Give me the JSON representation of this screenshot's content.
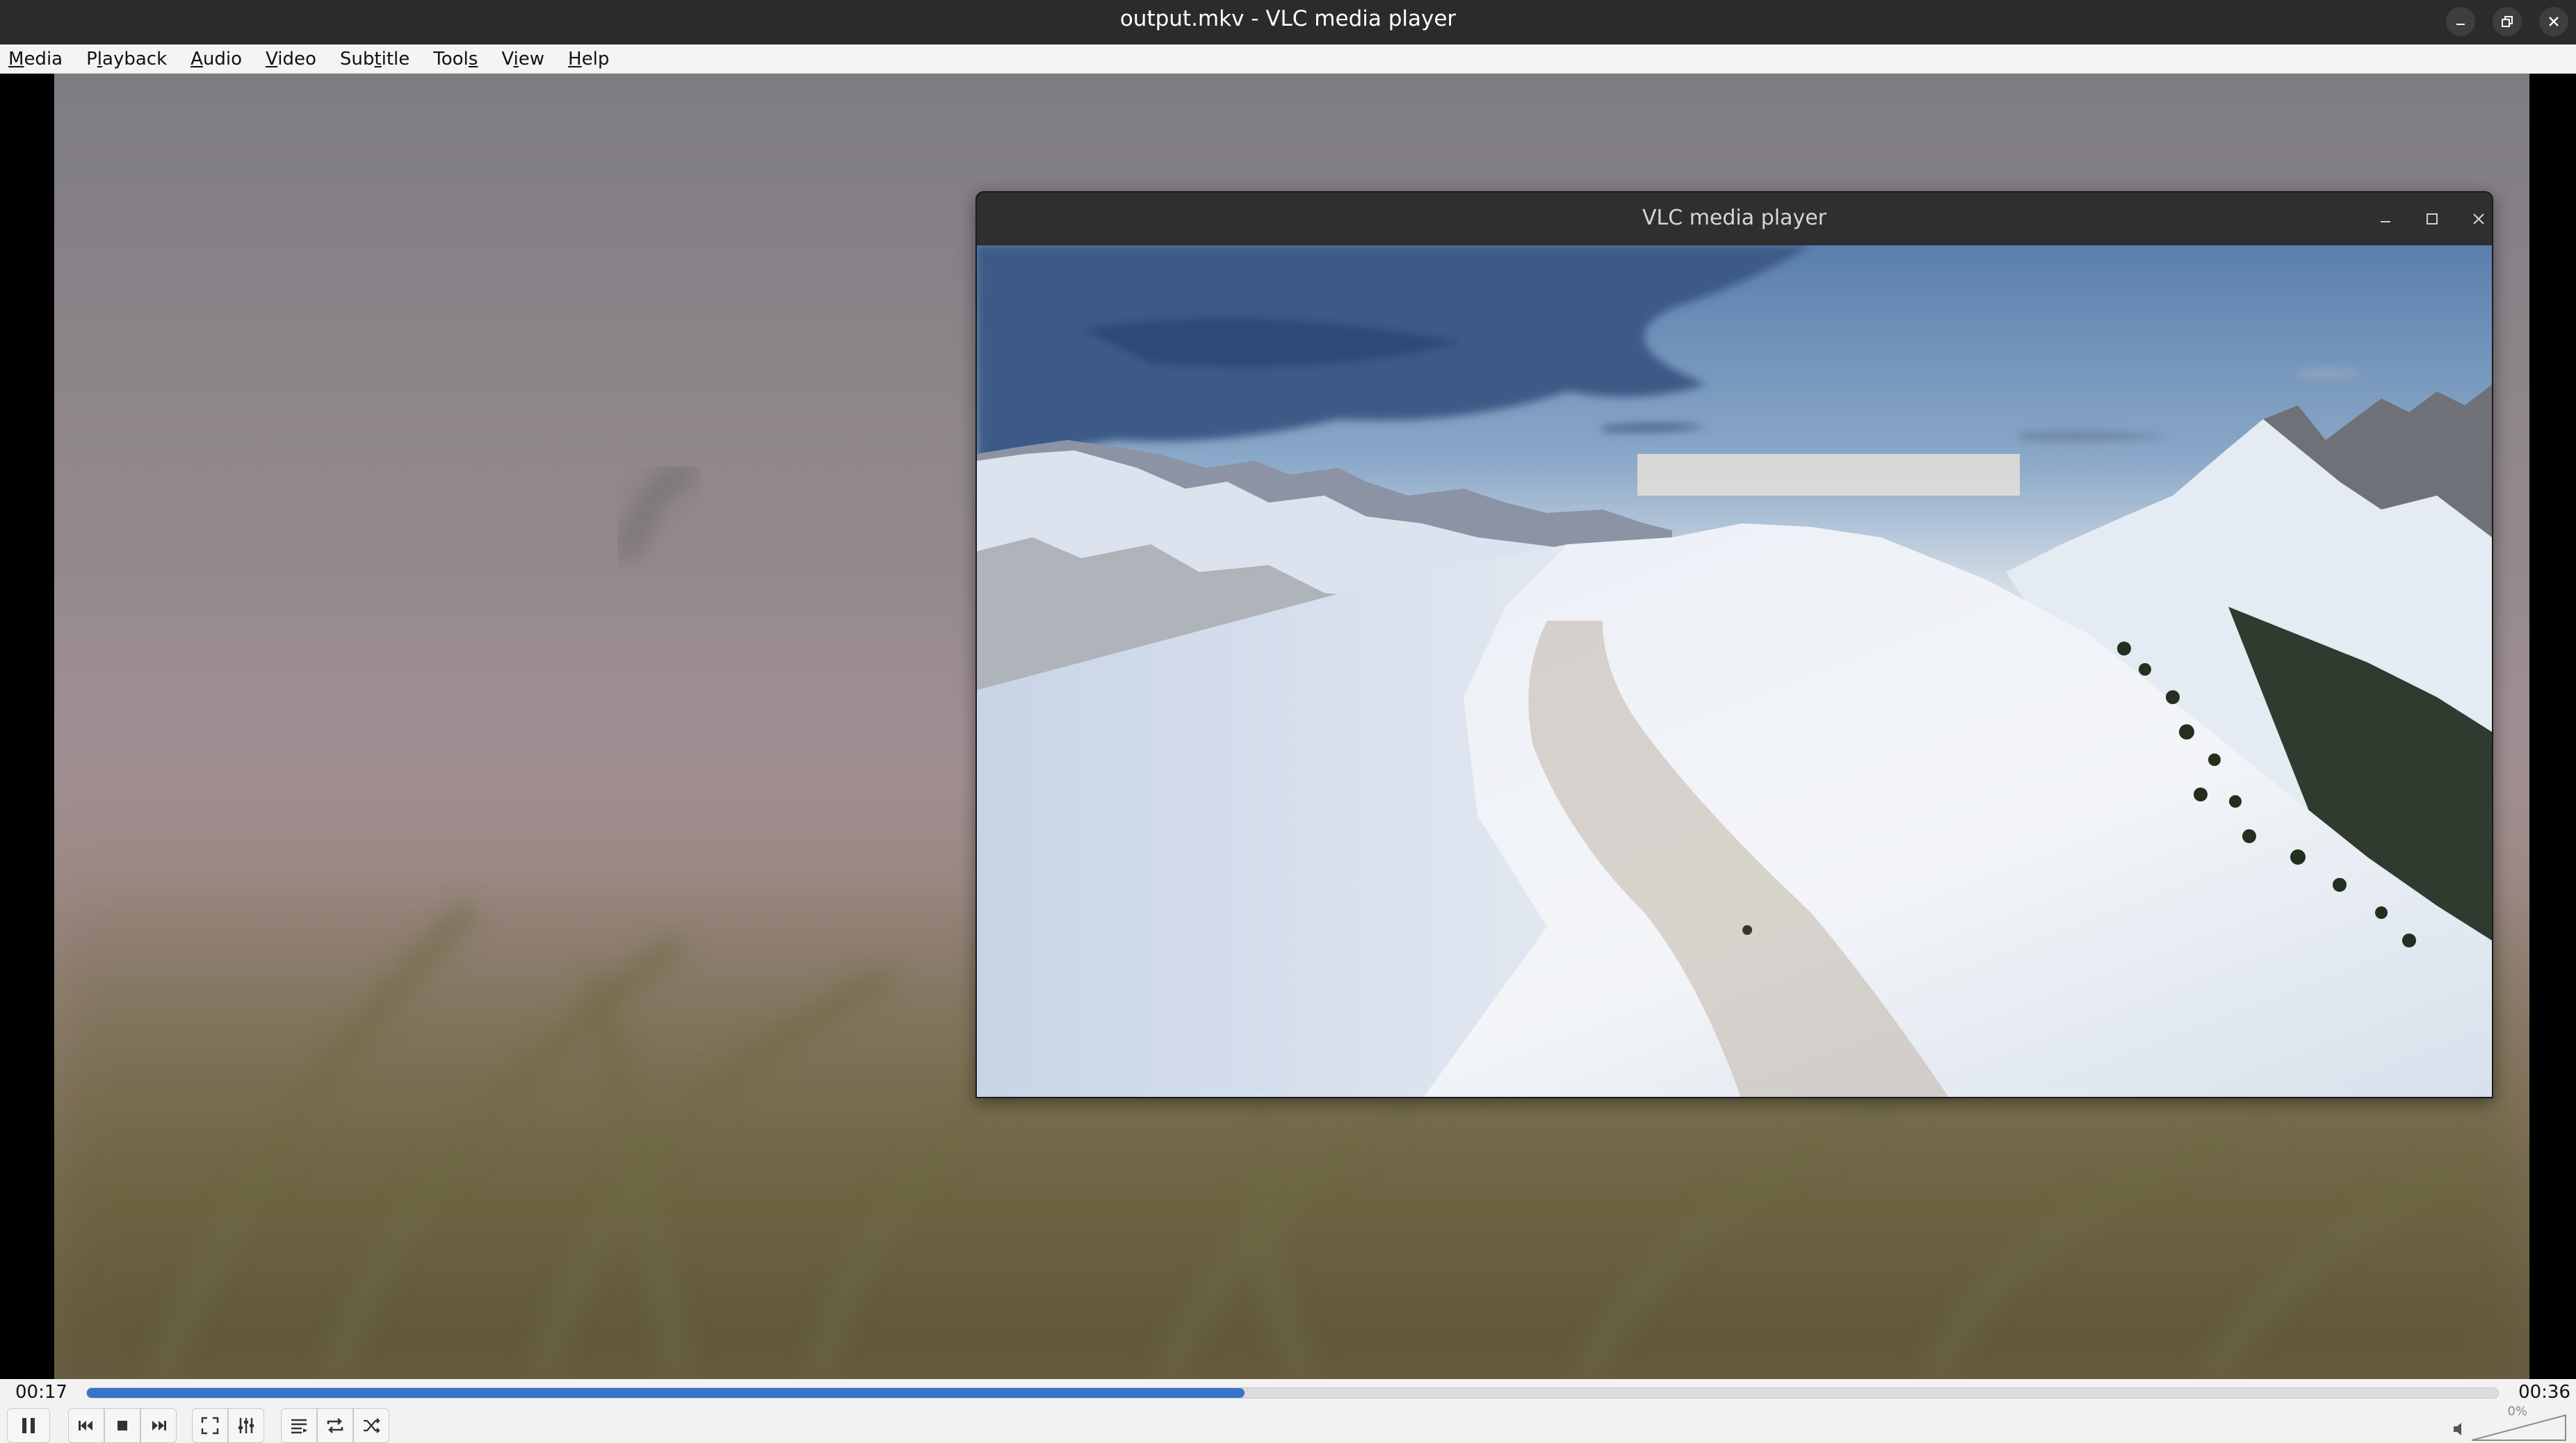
{
  "window": {
    "title": "output.mkv - VLC media player",
    "controls": [
      "minimize-icon",
      "restore-icon",
      "close-icon"
    ]
  },
  "menu": [
    {
      "label": "Media",
      "mnemonic": "M"
    },
    {
      "label": "Playback",
      "mnemonic": "l"
    },
    {
      "label": "Audio",
      "mnemonic": "A"
    },
    {
      "label": "Video",
      "mnemonic": "V"
    },
    {
      "label": "Subtitle",
      "mnemonic": "t"
    },
    {
      "label": "Tools",
      "mnemonic": "s"
    },
    {
      "label": "View",
      "mnemonic": "i"
    },
    {
      "label": "Help",
      "mnemonic": "H"
    }
  ],
  "sub_window": {
    "title": "VLC media player",
    "controls": [
      "minimize-icon",
      "maximize-icon",
      "close-icon"
    ]
  },
  "playback": {
    "elapsed": "00:17",
    "total": "00:36",
    "progress": 0.48
  },
  "volume": {
    "label": "0%",
    "level": 0
  },
  "controls": [
    "pause-icon",
    "previous-icon",
    "stop-icon",
    "next-icon",
    "fullscreen-icon",
    "extended-settings-icon",
    "playlist-icon",
    "loop-icon",
    "shuffle-icon"
  ],
  "colors": {
    "accent": "#3574c9",
    "titlebar": "#2b2b2b",
    "menubar": "#f4f4f4"
  }
}
